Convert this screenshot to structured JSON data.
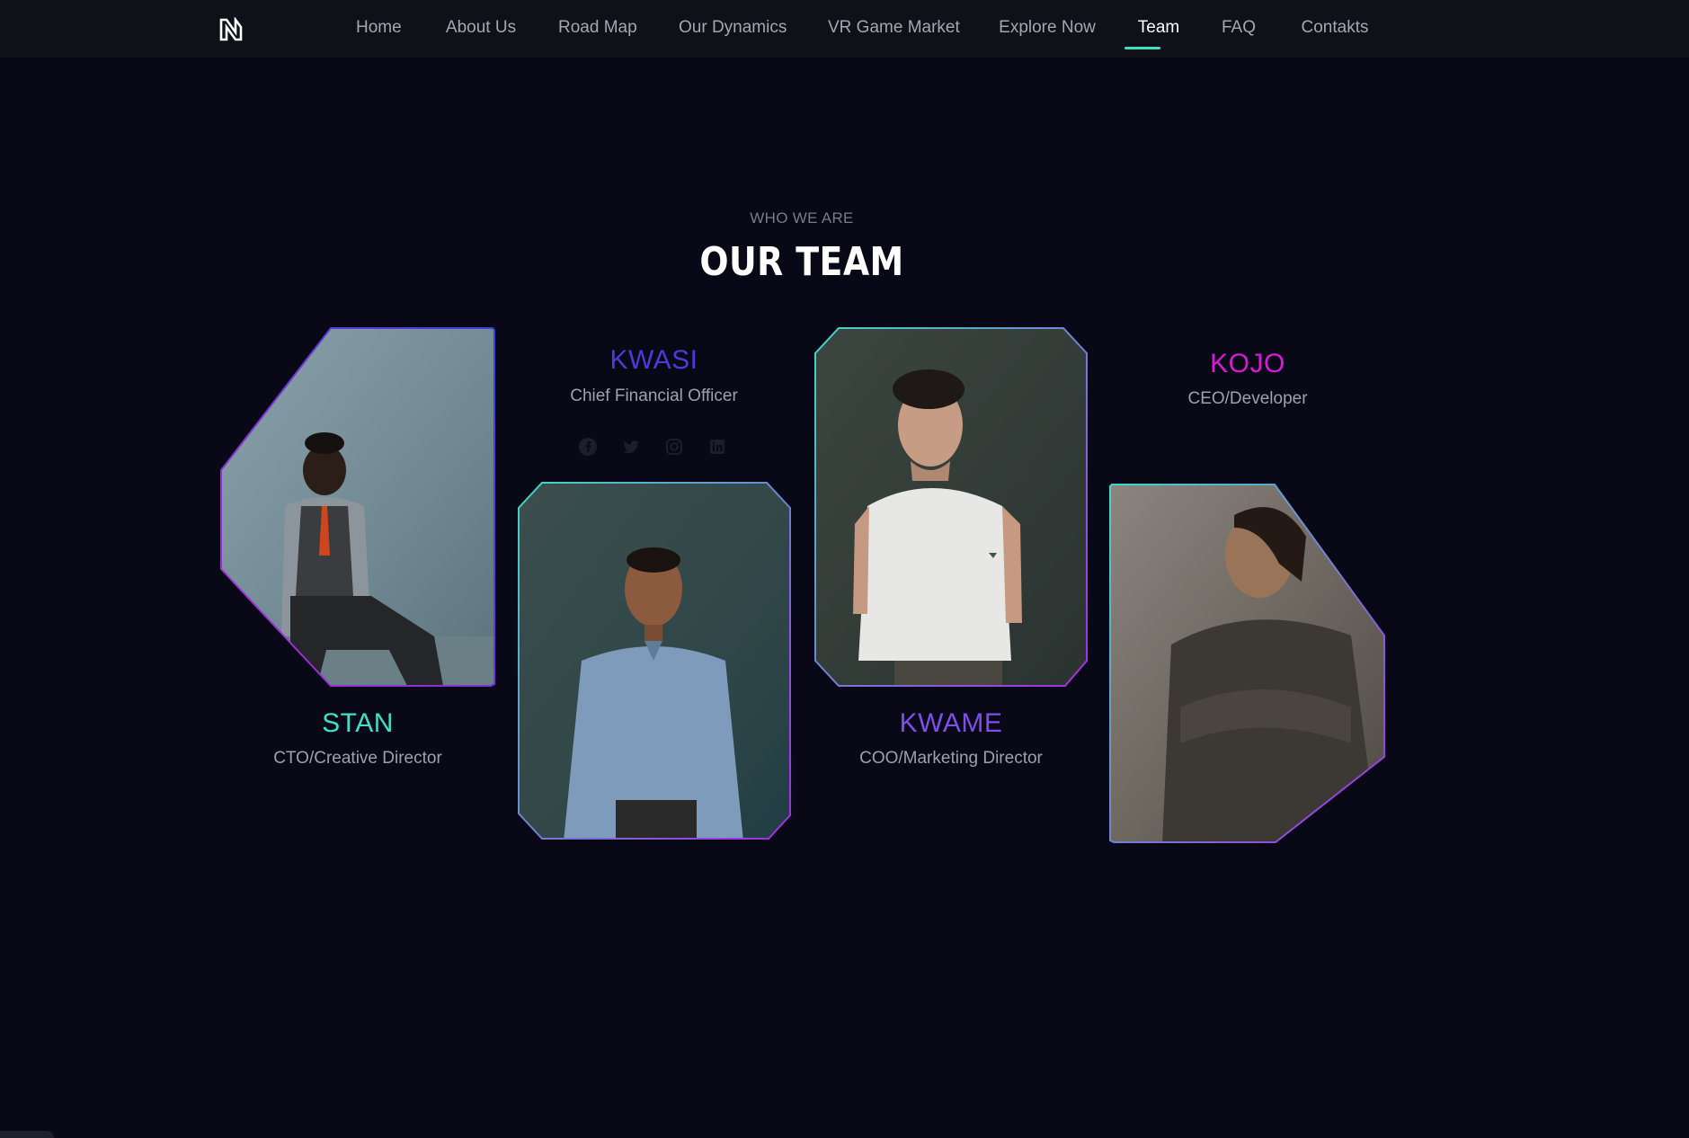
{
  "nav": {
    "items": [
      {
        "label": "Home"
      },
      {
        "label": "About Us"
      },
      {
        "label": "Road Map"
      },
      {
        "label": "Our Dynamics"
      },
      {
        "label": "VR Game Market"
      },
      {
        "label": "Explore Now"
      },
      {
        "label": "Team"
      },
      {
        "label": "FAQ"
      },
      {
        "label": "Contakts"
      }
    ],
    "active": "Team"
  },
  "section": {
    "eyebrow": "WHO WE ARE",
    "title": "OUR TEAM"
  },
  "team": [
    {
      "name": "STAN",
      "role": "CTO/Creative Director",
      "color": "#3fe0c5"
    },
    {
      "name": "KWASI",
      "role": "Chief Financial Officer",
      "color": "#4b3bd9"
    },
    {
      "name": "KWAME",
      "role": "COO/Marketing Director",
      "color": "#7e4ee8"
    },
    {
      "name": "KOJO",
      "role": "CEO/Developer",
      "color": "#d61ad6"
    }
  ],
  "socials": [
    "facebook-icon",
    "twitter-icon",
    "instagram-icon",
    "linkedin-icon"
  ],
  "colors": {
    "background": "#090817",
    "navbar": "#101019",
    "accent": "#3de0c4",
    "border_start": "#3fd8c6",
    "border_end": "#a52be0"
  }
}
